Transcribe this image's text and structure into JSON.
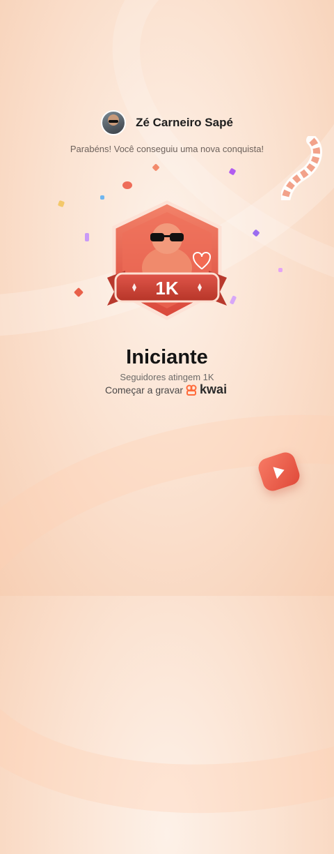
{
  "user": {
    "name": "Zé Carneiro Sapé"
  },
  "message": "Parabéns! Você conseguiu uma nova conquista!",
  "badge": {
    "level": "1K"
  },
  "achievement": {
    "title": "Iniciante",
    "description": "Seguidores atingem 1K",
    "cta": "Começar a gravar",
    "brand": "kwai"
  },
  "colors": {
    "accent": "#e5533f",
    "badge_dark": "#b93b31",
    "brand": "#ff6a3a"
  }
}
